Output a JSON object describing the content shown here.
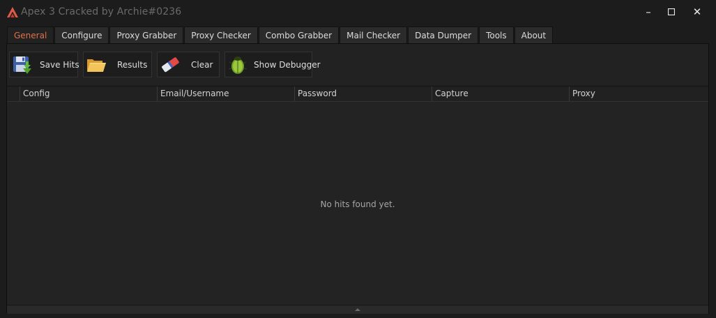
{
  "window": {
    "title": "Apex 3 Cracked by Archie#0236",
    "controls": {
      "minimize": "–",
      "maximize": "☐",
      "close": "✕"
    }
  },
  "tabs": [
    {
      "label": "General",
      "active": true
    },
    {
      "label": "Configure"
    },
    {
      "label": "Proxy Grabber"
    },
    {
      "label": "Proxy Checker"
    },
    {
      "label": "Combo Grabber"
    },
    {
      "label": "Mail Checker"
    },
    {
      "label": "Data Dumper"
    },
    {
      "label": "Tools"
    },
    {
      "label": "About"
    }
  ],
  "toolbar": {
    "save_hits": "Save Hits",
    "results": "Results",
    "clear": "Clear",
    "show_debugger": "Show Debugger"
  },
  "grid": {
    "columns": [
      "Config",
      "Email/Username",
      "Password",
      "Capture",
      "Proxy"
    ],
    "empty_message": "No hits found yet."
  },
  "colors": {
    "accent": "#e0714a",
    "background": "#1c1c1c",
    "panel": "#222222"
  },
  "icons": {
    "logo": "apex-logo-icon",
    "save_hits": "floppy-disk-icon",
    "results": "folder-icon",
    "clear": "eraser-icon",
    "show_debugger": "bug-icon",
    "collapse": "chevron-up-icon"
  }
}
